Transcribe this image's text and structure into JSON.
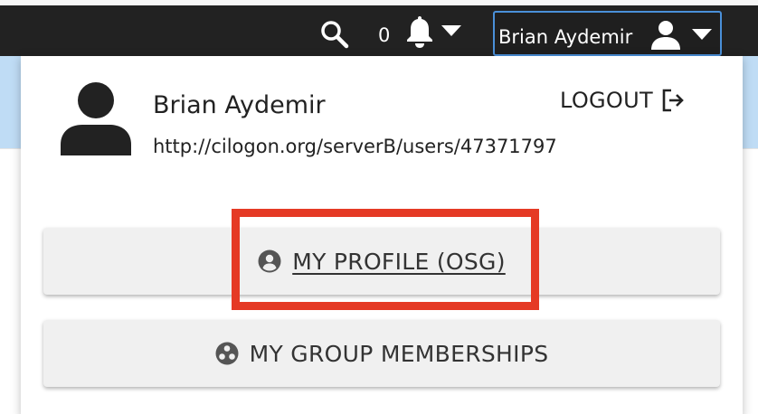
{
  "topbar": {
    "notification_count": "0",
    "user_button_label": "Brian Aydemir"
  },
  "dropdown": {
    "name": "Brian Aydemir",
    "identity": "http://cilogon.org/serverB/users/47371797",
    "logout_label": "LOGOUT",
    "profile_button_label": "MY PROFILE (OSG)",
    "groups_button_label": "MY GROUP MEMBERSHIPS"
  },
  "icons": {
    "search": "search-icon",
    "bell": "bell-icon",
    "caret": "chevron-down-icon",
    "user": "user-icon",
    "logout": "logout-icon",
    "profile": "user-circle-icon",
    "groups": "group-circle-icon"
  },
  "colors": {
    "topbar": "#222222",
    "blue_band": "#bfdcf5",
    "focus_border": "#4a90d9",
    "highlight": "#e53a25",
    "button_bg": "#f0f0f0"
  }
}
